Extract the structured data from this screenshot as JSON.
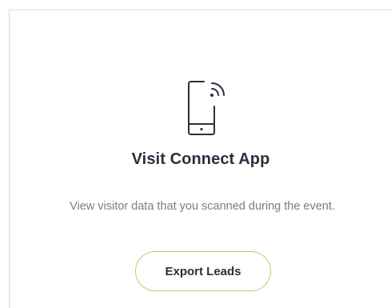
{
  "card": {
    "icon": "mobile-phone-signal-icon",
    "title": "Visit Connect App",
    "description": "View visitor data that you scanned during the event.",
    "button_label": "Export Leads"
  },
  "colors": {
    "title": "#2b2f3e",
    "description": "#7a7d86",
    "button_border": "#a6d56a",
    "card_border": "#dcdcdc"
  }
}
